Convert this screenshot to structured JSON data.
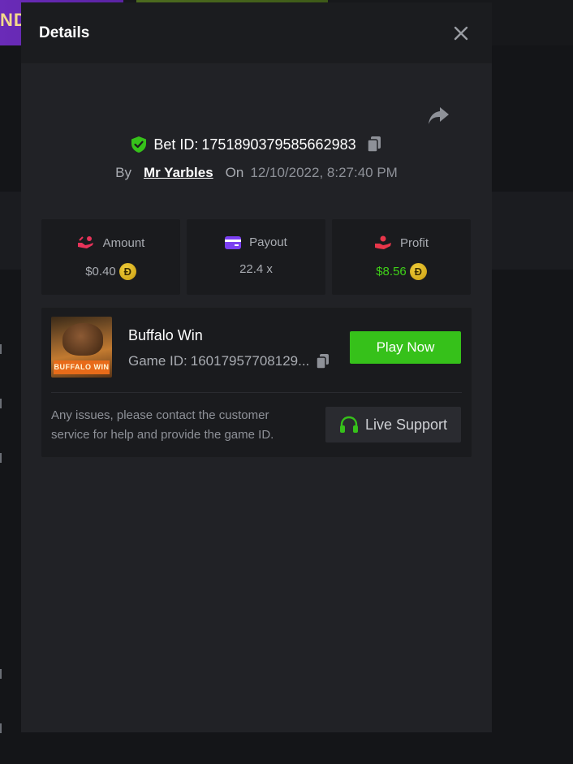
{
  "background": {
    "banner_text": "ND"
  },
  "modal": {
    "title": "Details"
  },
  "bet": {
    "id_label": "Bet ID:",
    "id_value": "1751890379585662983",
    "by_label": "By",
    "user": "Mr Yarbles",
    "on_label": "On",
    "date": "12/10/2022, 8:27:40 PM"
  },
  "stats": [
    {
      "label": "Amount",
      "value": "$0.40",
      "icon": "hand-coins-icon",
      "coin": "Đ"
    },
    {
      "label": "Payout",
      "value": "22.4 x",
      "icon": "card-icon"
    },
    {
      "label": "Profit",
      "value": "$8.56",
      "icon": "hand-gift-icon",
      "coin": "Đ"
    }
  ],
  "game": {
    "thumb_label": "BUFFALO WIN",
    "name": "Buffalo Win",
    "id_label": "Game ID:",
    "id_value": "16017957708129...",
    "play_label": "Play Now",
    "notice": "Any issues, please contact the customer service for help and provide the game ID.",
    "support_label": "Live Support"
  },
  "colors": {
    "accent_green": "#36c11a",
    "profit_green": "#3fd118",
    "amount_pink": "#e8335a",
    "payout_purple": "#7b3ff2",
    "profit_red": "#e8364a",
    "coin_gold": "#e0b521"
  }
}
